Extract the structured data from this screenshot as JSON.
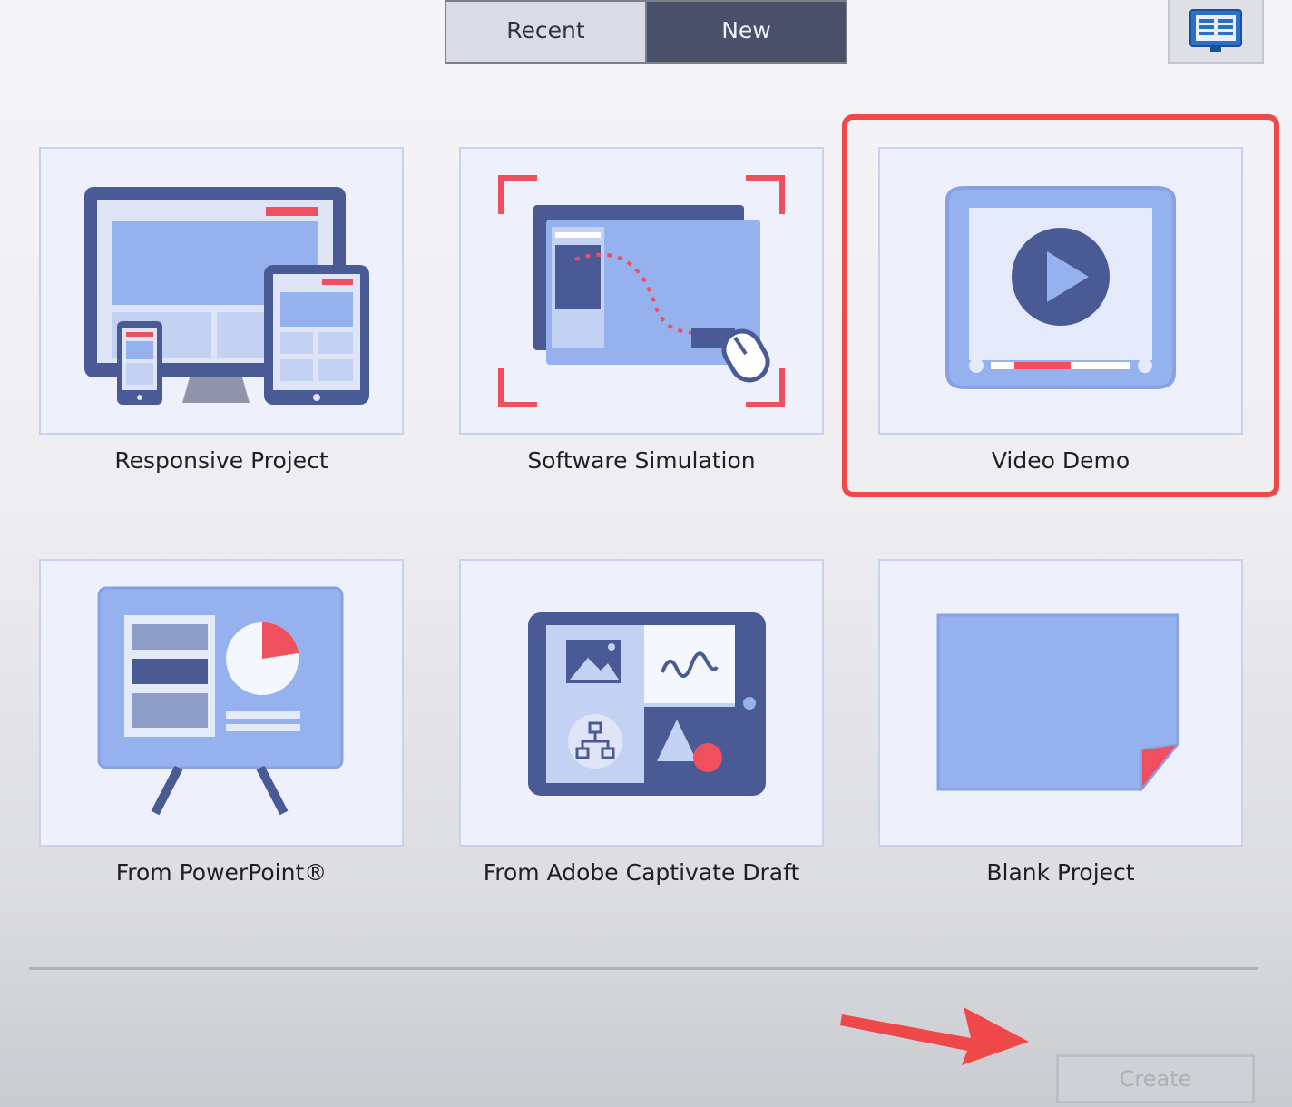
{
  "tabs": {
    "recent_label": "Recent",
    "new_label": "New",
    "active": "New"
  },
  "view_toggle": {
    "icon": "layout-icon"
  },
  "templates": [
    {
      "label": "Responsive Project",
      "icon": "responsive-devices-icon"
    },
    {
      "label": "Software Simulation",
      "icon": "software-simulation-icon"
    },
    {
      "label": "Video Demo",
      "icon": "video-play-icon",
      "highlighted": true
    },
    {
      "label": "From PowerPoint®",
      "icon": "presentation-easel-icon"
    },
    {
      "label": "From Adobe Captivate Draft",
      "icon": "tablet-draft-icon"
    },
    {
      "label": "Blank Project",
      "icon": "blank-page-icon"
    }
  ],
  "footer": {
    "create_label": "Create",
    "create_enabled": false
  },
  "colors": {
    "primary": "#4a5a94",
    "light": "#96b2ee",
    "accent": "#ef4f5f",
    "annotation": "#ef4848"
  }
}
